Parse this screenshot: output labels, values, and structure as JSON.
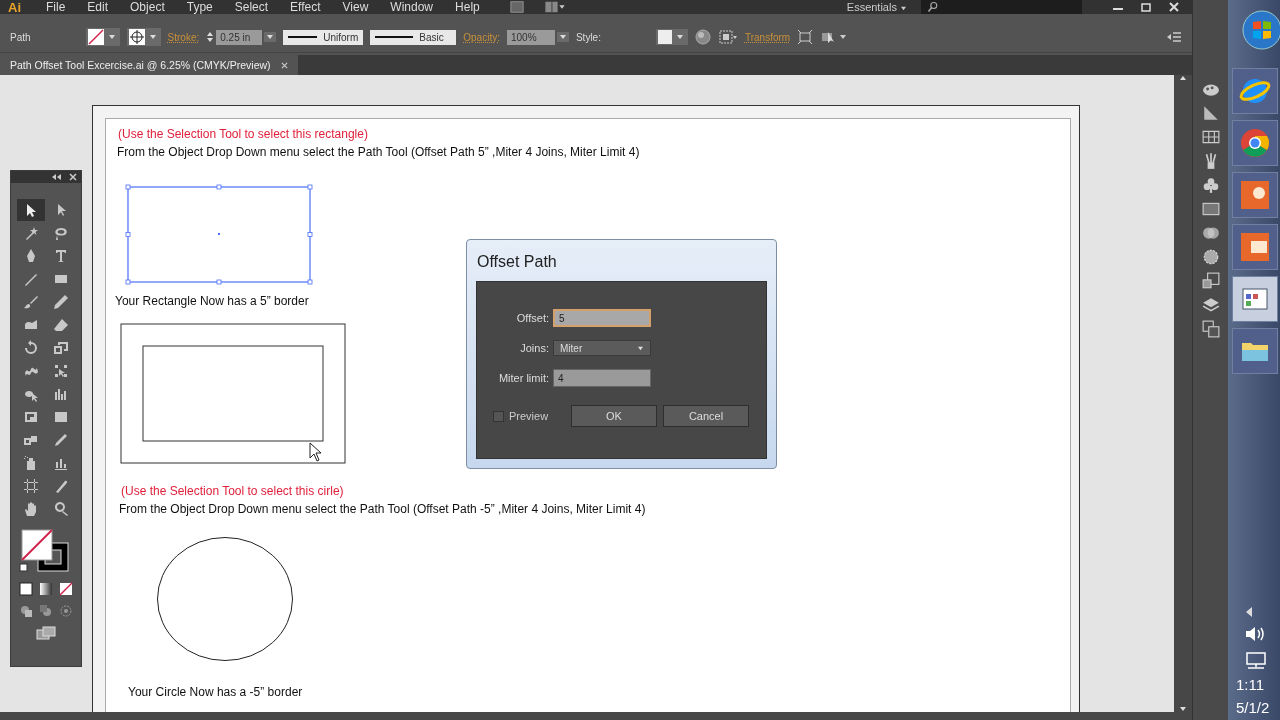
{
  "app": {
    "logo": "Ai",
    "menu": [
      "File",
      "Edit",
      "Object",
      "Type",
      "Select",
      "Effect",
      "View",
      "Window",
      "Help"
    ],
    "workspace": "Essentials"
  },
  "options_bar": {
    "selection": "Path",
    "stroke_label": "Stroke:",
    "stroke_weight": "0.25 in",
    "profile": "Uniform",
    "brush": "Basic",
    "opacity_label": "Opacity:",
    "opacity": "100%",
    "style_label": "Style:",
    "transform": "Transform"
  },
  "document_tab": {
    "title": "Path Offset Tool Excercise.ai @ 6.25% (CMYK/Preview)"
  },
  "tools": [
    {
      "kind": "selection",
      "selected": true
    },
    {
      "kind": "direct-selection",
      "selected": false
    },
    {
      "kind": "magic-wand",
      "selected": false
    },
    {
      "kind": "lasso",
      "selected": false
    },
    {
      "kind": "pen",
      "selected": false
    },
    {
      "kind": "type",
      "selected": false
    },
    {
      "kind": "line",
      "selected": false
    },
    {
      "kind": "rectangle",
      "selected": false
    },
    {
      "kind": "paintbrush",
      "selected": false
    },
    {
      "kind": "pencil",
      "selected": false
    },
    {
      "kind": "blob-brush",
      "selected": false
    },
    {
      "kind": "eraser",
      "selected": false
    },
    {
      "kind": "rotate",
      "selected": false
    },
    {
      "kind": "scale",
      "selected": false
    },
    {
      "kind": "warp",
      "selected": false
    },
    {
      "kind": "free-transform",
      "selected": false
    },
    {
      "kind": "shape-builder",
      "selected": false
    },
    {
      "kind": "graph",
      "selected": false
    },
    {
      "kind": "mesh",
      "selected": false
    },
    {
      "kind": "gradient",
      "selected": false
    },
    {
      "kind": "blend",
      "selected": false
    },
    {
      "kind": "eyedropper",
      "selected": false
    },
    {
      "kind": "symbol-sprayer",
      "selected": false
    },
    {
      "kind": "column-graph",
      "selected": false
    },
    {
      "kind": "artboard",
      "selected": false
    },
    {
      "kind": "slice",
      "selected": false
    },
    {
      "kind": "hand",
      "selected": false
    },
    {
      "kind": "zoom",
      "selected": false
    }
  ],
  "rectangle_exercise": {
    "hint": "(Use the Selection Tool to select this rectangle)",
    "instruction": "From the Object Drop Down menu select the Path Tool (Offset Path  5” ,Miter 4 Joins, Miter  Limit 4)",
    "selected": true,
    "result": "Your Rectangle Now has a 5” border"
  },
  "circle_exercise": {
    "hint": "(Use the Selection Tool to select this cirle)",
    "instruction": "From the Object Drop Down menu select the Path Tool (Offset Path  -5” ,Miter 4 Joins, Miter  Limit 4)",
    "result": "Your Circle Now has a -5” border"
  },
  "dialog": {
    "title": "Offset Path",
    "fields": [
      {
        "kind": "text",
        "label": "Offset:",
        "value": "5",
        "focused": true
      },
      {
        "kind": "dropdown",
        "label": "Joins:",
        "value": "Miter",
        "focused": false
      },
      {
        "kind": "text",
        "label": "Miter limit:",
        "value": "4",
        "focused": false
      }
    ],
    "preview": {
      "label": "Preview",
      "checked": false
    },
    "buttons": [
      "OK",
      "Cancel"
    ]
  },
  "taskbar": {
    "time": "1:11",
    "date": "5/1/2"
  }
}
